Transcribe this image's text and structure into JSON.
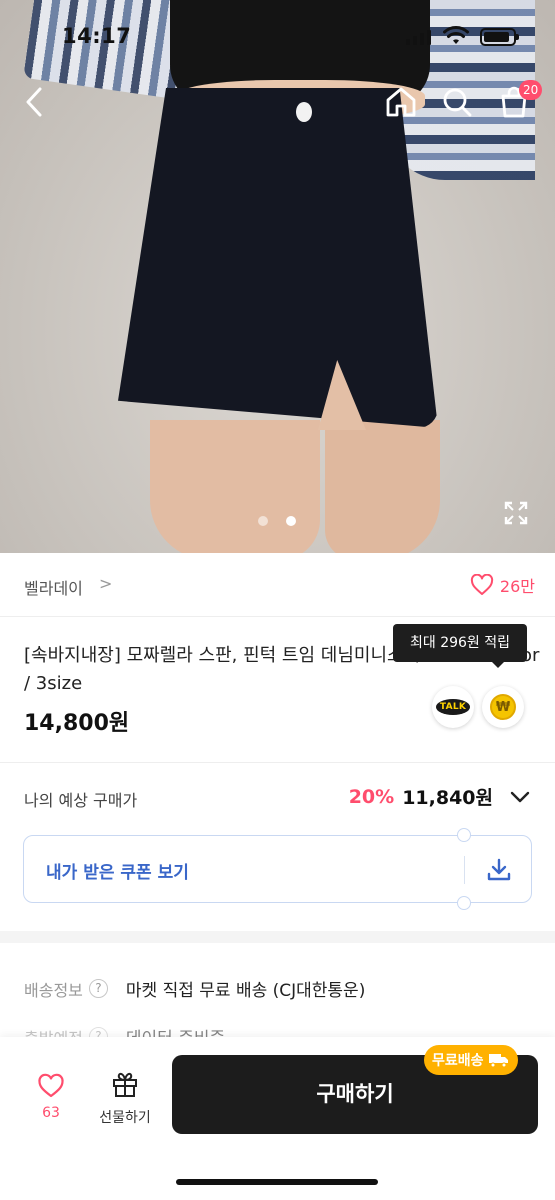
{
  "status_bar": {
    "time": "14:17"
  },
  "header": {
    "cart_count": "20"
  },
  "gallery": {
    "total_images": 2,
    "current_index": 2
  },
  "store": {
    "name": "벨라데이",
    "chevron": ">",
    "like_count": "26만"
  },
  "product": {
    "title": "[속바지내장] 모짜렐라 스판, 핀턱 트임 데님미니스커트 SK - 2color / 3size",
    "price": "14,800원",
    "points_tooltip": "최대 296원 적립",
    "talk_label": "TALK",
    "point_symbol": "₩"
  },
  "expected_price": {
    "label": "나의 예상 구매가",
    "discount": "20%",
    "value": "11,840원"
  },
  "coupon": {
    "label": "내가 받은 쿠폰 보기"
  },
  "shipping": {
    "key": "배송정보",
    "value": "마켓 직접 무료 배송 (CJ대한통운)",
    "key2": "출발예정",
    "value2": "데이터 준비중"
  },
  "bottom_bar": {
    "like_count": "63",
    "gift_label": "선물하기",
    "buy_label": "구매하기",
    "free_shipping_badge": "무료배송"
  },
  "colors": {
    "accent": "#ff4d6d",
    "link": "#3a67c9",
    "badge": "#ffb100",
    "buy": "#1c1c1c"
  }
}
